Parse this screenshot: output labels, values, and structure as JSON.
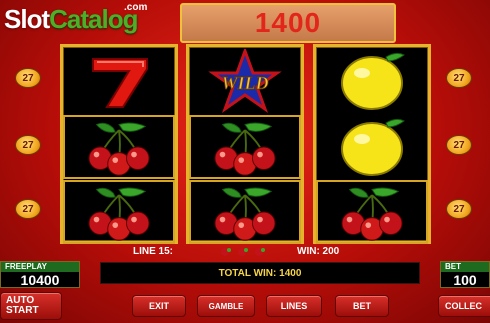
{
  "logo": {
    "part1": "Slot",
    "part2": "Catalog",
    "suffix": ".com"
  },
  "top_display": {
    "win_value": "1400"
  },
  "reels": [
    {
      "symbols": [
        "seven",
        "cherries",
        "cherries"
      ],
      "framed": [
        false,
        true,
        true
      ]
    },
    {
      "symbols": [
        "wild-star",
        "cherries",
        "cherries"
      ],
      "framed": [
        false,
        true,
        true
      ]
    },
    {
      "symbols": [
        "lemon",
        "lemon",
        "cherries"
      ],
      "framed": [
        false,
        false,
        true
      ]
    }
  ],
  "wild_text": "WILD",
  "line_badges": {
    "left": [
      "27",
      "27",
      "27"
    ],
    "right": [
      "27",
      "27",
      "27"
    ]
  },
  "info": {
    "line": "LINE 15:",
    "win": "WIN: 200",
    "total_win": "TOTAL WIN: 1400"
  },
  "freeplay": {
    "label": "FREEPLAY",
    "value": "10400"
  },
  "bet": {
    "label": "BET",
    "value": "100"
  },
  "buttons": {
    "auto_line1": "AUTO",
    "auto_line2": "START",
    "exit": "EXIT",
    "gamble": "GAMBLE",
    "lines": "LINES",
    "bet": "BET",
    "collect": "COLLEC"
  },
  "colors": {
    "background": "#c0100a",
    "reel_frame": "#e5b42c",
    "win_text": "#e3261b",
    "total_win_text": "#f6d44a"
  }
}
